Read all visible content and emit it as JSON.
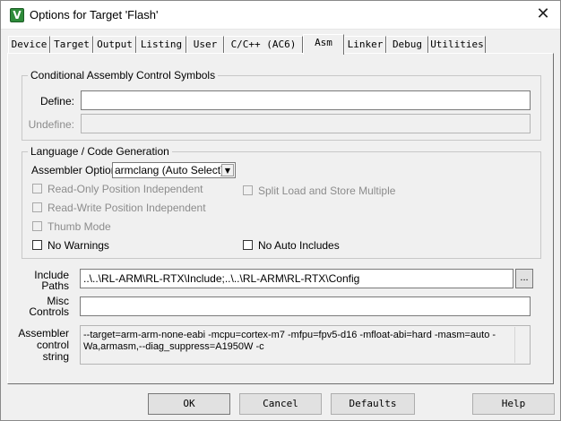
{
  "window": {
    "title": "Options for Target 'Flash'",
    "app_icon": "V"
  },
  "tabs": [
    "Device",
    "Target",
    "Output",
    "Listing",
    "User",
    "C/C++ (AC6)",
    "Asm",
    "Linker",
    "Debug",
    "Utilities"
  ],
  "active_tab": "Asm",
  "conditional": {
    "title": "Conditional Assembly Control Symbols",
    "define_label": "Define:",
    "define_value": "",
    "undefine_label": "Undefine:",
    "undefine_value": ""
  },
  "language": {
    "title": "Language / Code Generation",
    "assembler_option_label": "Assembler Option:",
    "assembler_option_value": "armclang (Auto Select)",
    "checkboxes": {
      "read_only_pi": {
        "label": "Read-Only Position Independent",
        "checked": false,
        "enabled": false
      },
      "read_write_pi": {
        "label": "Read-Write Position Independent",
        "checked": false,
        "enabled": false
      },
      "thumb_mode": {
        "label": "Thumb Mode",
        "checked": false,
        "enabled": false
      },
      "no_warnings": {
        "label": "No Warnings",
        "checked": false,
        "enabled": true
      },
      "split_load_store": {
        "label": "Split Load and Store Multiple",
        "checked": false,
        "enabled": false
      },
      "no_auto_includes": {
        "label": "No Auto Includes",
        "checked": false,
        "enabled": true
      }
    }
  },
  "include_paths": {
    "label_line1": "Include",
    "label_line2": "Paths",
    "value": "..\\..\\RL-ARM\\RL-RTX\\Include;..\\..\\RL-ARM\\RL-RTX\\Config",
    "browse_label": "..."
  },
  "misc_controls": {
    "label_line1": "Misc",
    "label_line2": "Controls",
    "value": ""
  },
  "assembler_control": {
    "label_line1": "Assembler",
    "label_line2": "control",
    "label_line3": "string",
    "line1": "--target=arm-arm-none-eabi -mcpu=cortex-m7 -mfpu=fpv5-d16 -mfloat-abi=hard -masm=auto  -",
    "line2": "Wa,armasm,--diag_suppress=A1950W -c"
  },
  "buttons": {
    "ok": "OK",
    "cancel": "Cancel",
    "defaults": "Defaults",
    "help": "Help"
  }
}
